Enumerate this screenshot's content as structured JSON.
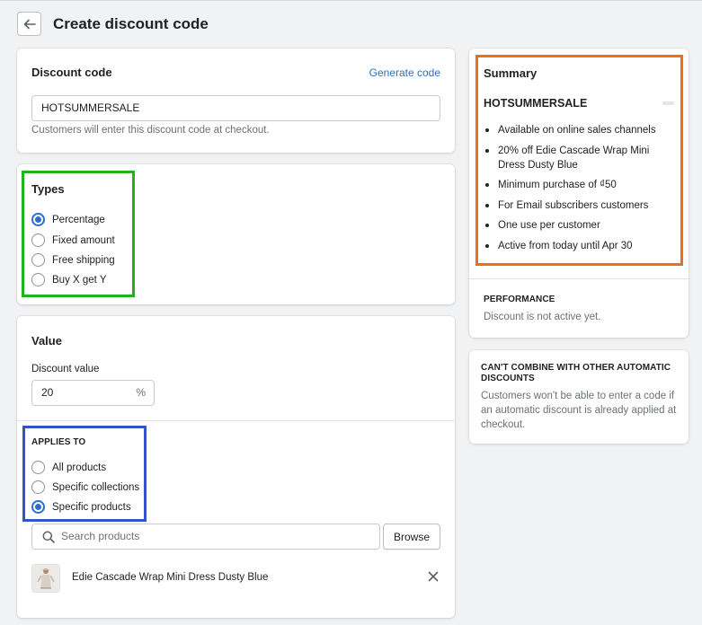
{
  "page": {
    "title": "Create discount code"
  },
  "discount_code": {
    "title": "Discount code",
    "generate_label": "Generate code",
    "value": "HOTSUMMERSALE",
    "help": "Customers will enter this discount code at checkout."
  },
  "types": {
    "title": "Types",
    "options": [
      "Percentage",
      "Fixed amount",
      "Free shipping",
      "Buy X get Y"
    ],
    "selected": "Percentage"
  },
  "value_section": {
    "title": "Value",
    "field_label": "Discount value",
    "field_value": "20",
    "suffix": "%",
    "applies_to_heading": "APPLIES TO",
    "applies_to_options": [
      "All products",
      "Specific collections",
      "Specific products"
    ],
    "applies_to_selected": "Specific products",
    "search_placeholder": "Search products",
    "browse_label": "Browse",
    "product_name": "Edie Cascade Wrap Mini Dress Dusty Blue"
  },
  "summary": {
    "title": "Summary",
    "code": "HOTSUMMERSALE",
    "items": [
      "Available on online sales channels",
      "20% off Edie Cascade Wrap Mini Dress Dusty Blue",
      "Minimum purchase of ₫50",
      "For Email subscribers customers",
      "One use per customer",
      "Active from today until Apr 30"
    ],
    "performance_heading": "PERFORMANCE",
    "performance_text": "Discount is not active yet."
  },
  "combine": {
    "heading": "CAN'T COMBINE WITH OTHER AUTOMATIC DISCOUNTS",
    "text": "Customers won't be able to enter a code if an automatic discount is already applied at checkout."
  },
  "colors": {
    "accent": "#2c6ecb",
    "highlight_green": "#1fb11f",
    "highlight_blue": "#3354c4",
    "highlight_orange": "#ec6f17"
  }
}
